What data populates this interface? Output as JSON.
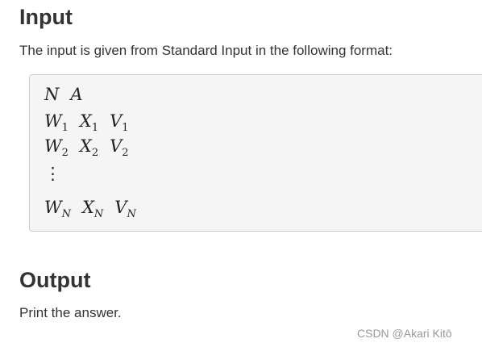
{
  "input": {
    "heading": "Input",
    "description": "The input is given from Standard Input in the following format:",
    "format": {
      "line1": [
        "N",
        "A"
      ],
      "line2": [
        {
          "v": "W",
          "s": "1"
        },
        {
          "v": "X",
          "s": "1"
        },
        {
          "v": "V",
          "s": "1"
        }
      ],
      "line3": [
        {
          "v": "W",
          "s": "2"
        },
        {
          "v": "X",
          "s": "2"
        },
        {
          "v": "V",
          "s": "2"
        }
      ],
      "vdots": "⋮",
      "lineN": [
        {
          "v": "W",
          "s": "N"
        },
        {
          "v": "X",
          "s": "N"
        },
        {
          "v": "V",
          "s": "N"
        }
      ]
    }
  },
  "output": {
    "heading": "Output",
    "description": "Print the answer."
  },
  "watermark": "CSDN @Akari  Kitō"
}
